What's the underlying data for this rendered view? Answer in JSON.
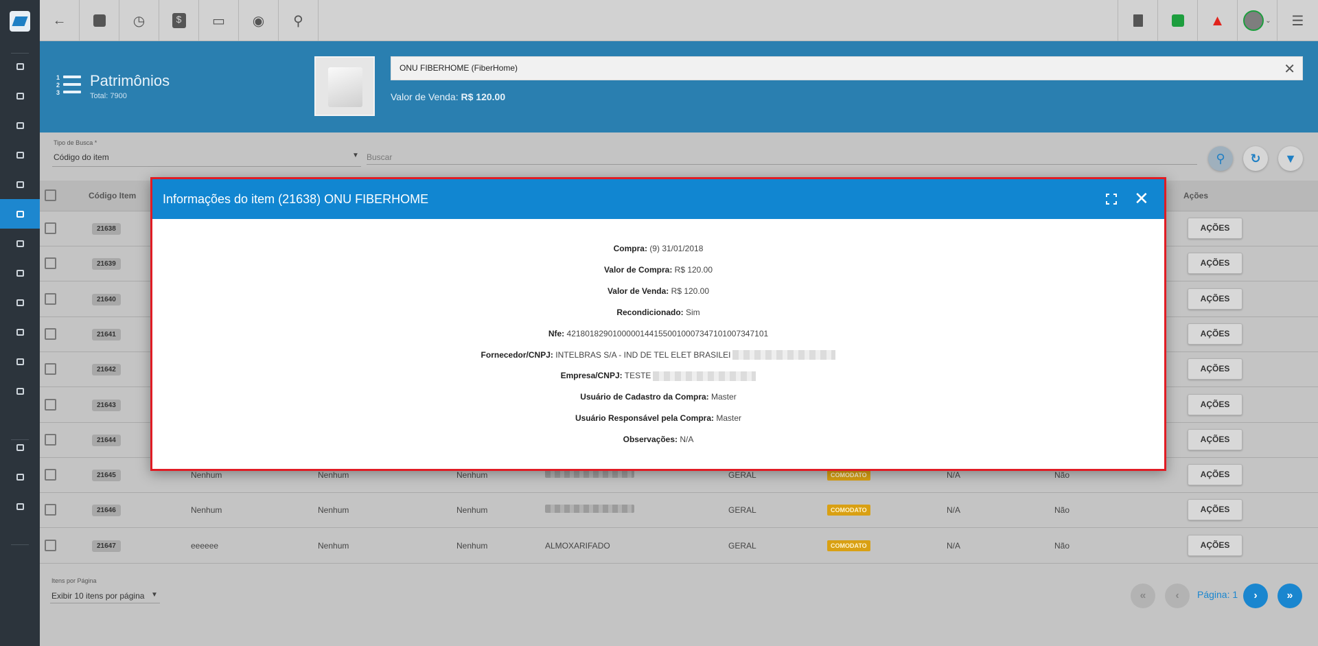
{
  "topbar": {
    "left_icons": [
      "back-arrow-icon",
      "contact-card-icon",
      "calendar-clock-icon",
      "dollar-icon",
      "terminal-icon",
      "eye-icon",
      "search-icon"
    ],
    "right_icons": [
      "pdf-doc-icon",
      "check-chat-icon",
      "alarm-bell-icon",
      "user-avatar-icon",
      "menu-list-icon"
    ],
    "colors": {
      "check": "#1d9e3e",
      "alarm": "#e0241d"
    }
  },
  "sidebar": {
    "icons": [
      "dashboard-icon",
      "pie-chart-icon",
      "contacts-icon",
      "board-icon",
      "calendar-icon",
      "box-icon",
      "id-card-icon",
      "map-pin-icon",
      "document-icon",
      "server-icon",
      "file-icon",
      "gear-icon",
      "video-icon",
      "wiki-icon",
      "chat-icon"
    ],
    "active_index": 5
  },
  "header": {
    "title": "Patrimônios",
    "total": "Total: 7900",
    "product_name": "ONU FIBERHOME  (FiberHome)",
    "sale_label": "Valor de Venda:",
    "sale_value": "R$ 120.00"
  },
  "search": {
    "type_label": "Tipo de Busca *",
    "type_value": "Código do item",
    "placeholder": "Buscar"
  },
  "table": {
    "headers": {
      "code": "Código Item",
      "actions": "Ações"
    },
    "rows": [
      {
        "code": "21638",
        "c1": "",
        "c2": "",
        "c3": "",
        "c4": "",
        "c5": "",
        "tag": "",
        "c6": "",
        "c7": "",
        "blur": false
      },
      {
        "code": "21639",
        "c1": "",
        "c2": "",
        "c3": "",
        "c4": "",
        "c5": "",
        "tag": "",
        "c6": "",
        "c7": "",
        "blur": false
      },
      {
        "code": "21640",
        "c1": "",
        "c2": "",
        "c3": "",
        "c4": "",
        "c5": "",
        "tag": "",
        "c6": "",
        "c7": "",
        "blur": false
      },
      {
        "code": "21641",
        "c1": "",
        "c2": "",
        "c3": "",
        "c4": "",
        "c5": "",
        "tag": "",
        "c6": "",
        "c7": "",
        "blur": false
      },
      {
        "code": "21642",
        "c1": "",
        "c2": "",
        "c3": "",
        "c4": "",
        "c5": "",
        "tag": "",
        "c6": "",
        "c7": "",
        "blur": false
      },
      {
        "code": "21643",
        "c1": "",
        "c2": "",
        "c3": "",
        "c4": "",
        "c5": "",
        "tag": "",
        "c6": "",
        "c7": "",
        "blur": false
      },
      {
        "code": "21644",
        "c1": "",
        "c2": "",
        "c3": "",
        "c4": "",
        "c5": "",
        "tag": "",
        "c6": "",
        "c7": "",
        "blur": false
      },
      {
        "code": "21645",
        "c1": "Nenhum",
        "c2": "Nenhum",
        "c3": "Nenhum",
        "c4": "",
        "c5": "GERAL",
        "tag": "COMODATO",
        "c6": "N/A",
        "c7": "Não",
        "blur": true
      },
      {
        "code": "21646",
        "c1": "Nenhum",
        "c2": "Nenhum",
        "c3": "Nenhum",
        "c4": "",
        "c5": "GERAL",
        "tag": "COMODATO",
        "c6": "N/A",
        "c7": "Não",
        "blur": true
      },
      {
        "code": "21647",
        "c1": "eeeeee",
        "c2": "Nenhum",
        "c3": "Nenhum",
        "c4": "ALMOXARIFADO",
        "c5": "GERAL",
        "tag": "COMODATO",
        "c6": "N/A",
        "c7": "Não",
        "blur": false
      }
    ],
    "action_label": "AÇÕES"
  },
  "pagination": {
    "ipp_label": "Itens por Página",
    "ipp_value": "Exibir 10 itens por página",
    "page_label": "Página: 1"
  },
  "modal": {
    "title": "Informações do item (21638) ONU FIBERHOME",
    "lines": [
      {
        "label": "Compra:",
        "value": "(9) 31/01/2018",
        "redact": 0
      },
      {
        "label": "Valor de Compra:",
        "value": "R$ 120.00",
        "redact": 0
      },
      {
        "label": "Valor de Venda:",
        "value": "R$ 120.00",
        "redact": 0
      },
      {
        "label": "Recondicionado:",
        "value": "Sim",
        "redact": 0
      },
      {
        "label": "Nfe:",
        "value": "42180182901000001441550010007347101007347101",
        "redact": 0
      },
      {
        "label": "Fornecedor/CNPJ:",
        "value": "INTELBRAS S/A - IND DE TEL ELET BRASILEI",
        "redact": 150
      },
      {
        "label": "Empresa/CNPJ:",
        "value": "TESTE",
        "redact": 150
      },
      {
        "label": "Usuário de Cadastro da Compra:",
        "value": "Master",
        "redact": 0
      },
      {
        "label": "Usuário Responsável pela Compra:",
        "value": "Master",
        "redact": 0
      },
      {
        "label": "Observações:",
        "value": "N/A",
        "redact": 0
      }
    ]
  }
}
